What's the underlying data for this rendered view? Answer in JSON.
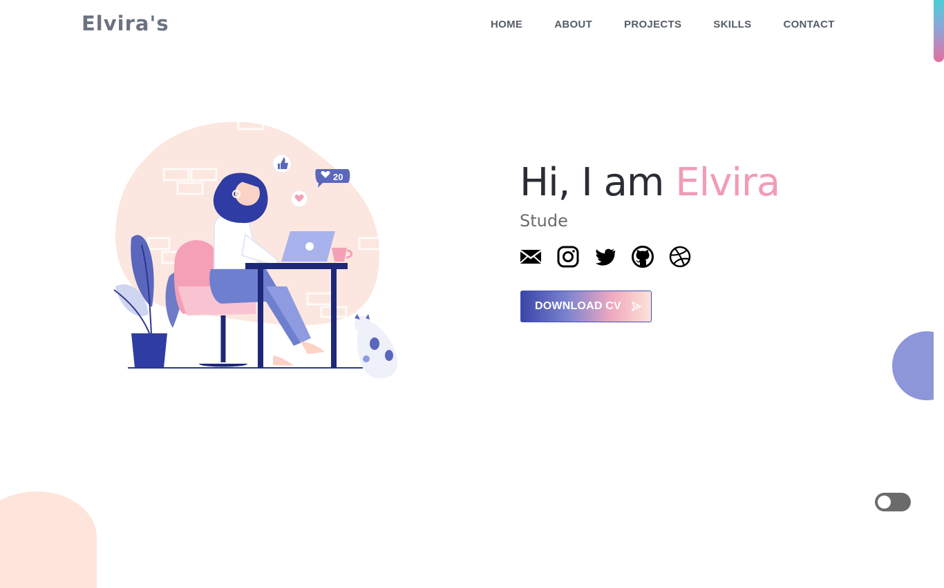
{
  "brand": {
    "name": "Elvira's"
  },
  "nav": {
    "items": [
      {
        "label": "HOME"
      },
      {
        "label": "ABOUT"
      },
      {
        "label": "PROJECTS"
      },
      {
        "label": "SKILLS"
      },
      {
        "label": "CONTACT"
      }
    ]
  },
  "hero": {
    "greeting_prefix": "Hi, I am ",
    "greeting_name": "Elvira",
    "typed_text": "Stude",
    "socials": [
      {
        "icon": "mail-icon"
      },
      {
        "icon": "instagram-icon"
      },
      {
        "icon": "twitter-icon"
      },
      {
        "icon": "github-icon"
      },
      {
        "icon": "dribbble-icon"
      }
    ],
    "cv_button": "DOWNLOAD CV",
    "illustration_badges": {
      "likes_count": "20"
    }
  },
  "colors": {
    "accent_pink": "#f29bb4",
    "accent_blue": "#3a45a8",
    "blob_blue": "#8c96d8",
    "blob_peach": "#fde5db"
  },
  "theme_toggle": {
    "state": "off"
  }
}
